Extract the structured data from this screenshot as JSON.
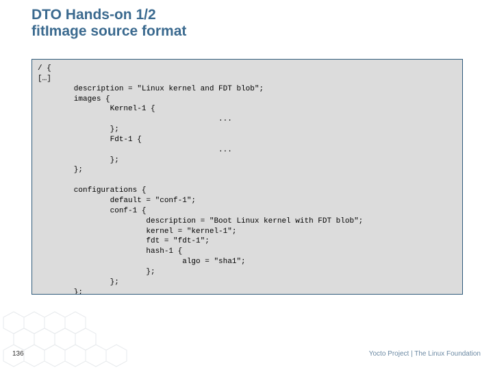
{
  "title_line1": "DTO Hands-on 1/2",
  "title_line2": "fitImage source format",
  "code": "/ {\n[…]\n        description = \"Linux kernel and FDT blob\";\n        images {\n                Kernel-1 {\n                                        ...\n                };\n                Fdt-1 {\n                                        ...\n                };\n        };\n\n        configurations {\n                default = \"conf-1\";\n                conf-1 {\n                        description = \"Boot Linux kernel with FDT blob\";\n                        kernel = \"kernel-1\";\n                        fdt = \"fdt-1\";\n                        hash-1 {\n                                algo = \"sha1\";\n                        };\n                };\n        };\n};",
  "page_number": "136",
  "footer": "Yocto Project | The Linux Foundation"
}
